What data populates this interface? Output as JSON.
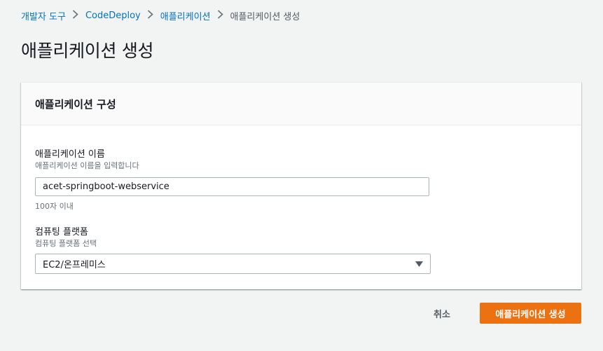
{
  "breadcrumb": {
    "items": [
      {
        "label": "개발자 도구"
      },
      {
        "label": "CodeDeploy"
      },
      {
        "label": "애플리케이션"
      },
      {
        "label": "애플리케이션 생성"
      }
    ]
  },
  "page": {
    "title": "애플리케이션 생성"
  },
  "panel": {
    "title": "애플리케이션 구성"
  },
  "app_name_field": {
    "label": "애플리케이션 이름",
    "description": "애플리케이션 이름을 입력합니다",
    "value": "acet-springboot-webservice",
    "constraint": "100자 이내"
  },
  "platform_field": {
    "label": "컴퓨팅 플랫폼",
    "description": "컴퓨팅 플랫폼 선택",
    "selected": "EC2/온프레미스"
  },
  "actions": {
    "cancel_label": "취소",
    "create_label": "애플리케이션 생성"
  },
  "colors": {
    "link": "#0073bb",
    "primary": "#ec7211",
    "background": "#f2f3f3"
  },
  "icons": {
    "separator": "chevron-right-icon",
    "dropdown": "caret-down-icon"
  }
}
